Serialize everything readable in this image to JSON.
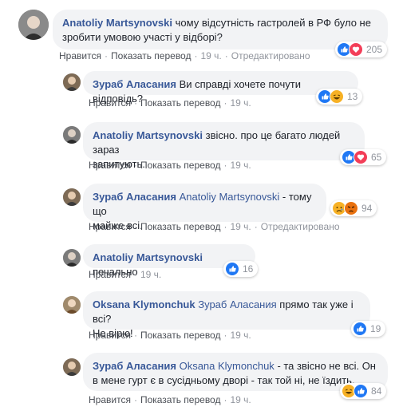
{
  "actions": {
    "like": "Нравится",
    "translate": "Показать перевод",
    "edited": "Отредактировано",
    "dot": "·"
  },
  "comments": [
    {
      "author": "Anatoliy Martsynovski",
      "text": "чому відсутність гастролей в РФ було не",
      "text2": "зробити умовою участі у відборі?",
      "time": "19 ч.",
      "reactions": [
        "like-icon",
        "love-icon"
      ],
      "count": "205"
    },
    {
      "author": "Зураб Аласания",
      "text": "Ви справді хочете почути відповідь?",
      "time": "19 ч.",
      "reactions": [
        "like-icon",
        "haha-icon"
      ],
      "count": "13"
    },
    {
      "author": "Anatoliy Martsynovski",
      "text": "звісно. про це багато людей зараз",
      "text2": "запитують.",
      "time": "19 ч.",
      "reactions": [
        "like-icon",
        "love-icon"
      ],
      "count": "65"
    },
    {
      "author": "Зураб Аласания",
      "tag": "Anatoliy Martsynovski",
      "text": "- тому що",
      "text2": "майже всі.",
      "time": "19 ч.",
      "reactions": [
        "sad-icon",
        "angry-icon"
      ],
      "count": "94"
    },
    {
      "author": "Anatoliy Martsynovski",
      "text": "печально",
      "time": "19 ч.",
      "reactions": [
        "like-icon"
      ],
      "count": "16"
    },
    {
      "author": "Oksana Klymonchuk",
      "tag": "Зураб Аласания",
      "text": "прямо так уже і всі?",
      "text2": "Не вірю!",
      "time": "19 ч.",
      "reactions": [
        "like-icon"
      ],
      "count": "19"
    },
    {
      "author": "Зураб Аласания",
      "tag": "Oksana Klymonchuk",
      "text": "- та звісно не всі. Он",
      "text2": "в мене гурт є в сусідньому дворі - так той ні, не їздить.",
      "time": "19 ч.",
      "reactions": [
        "haha-icon",
        "like-icon"
      ],
      "count": "84"
    }
  ],
  "colors": {
    "link": "#385898",
    "like": "#2078f4",
    "love": "#f33e58",
    "haha": "#f7b125",
    "angry": "#e9710f"
  }
}
